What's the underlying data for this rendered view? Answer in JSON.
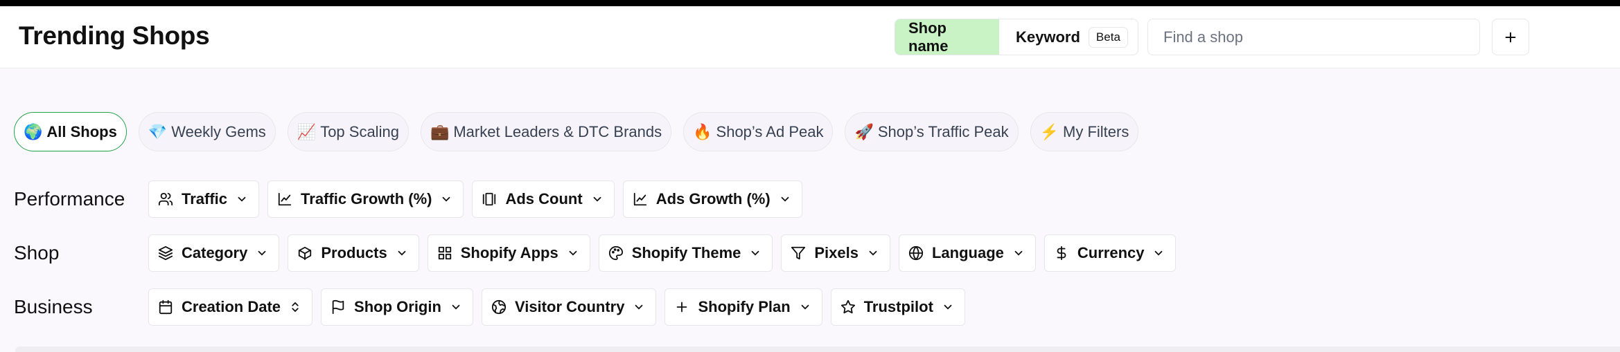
{
  "header": {
    "title": "Trending Shops",
    "mode_tabs": [
      {
        "label": "Shop name",
        "active": true
      },
      {
        "label": "Keyword",
        "badge": "Beta",
        "active": false
      }
    ],
    "search": {
      "placeholder": "Find a shop",
      "value": ""
    },
    "add_icon": "plus-icon"
  },
  "presets": [
    {
      "emoji": "🌍",
      "label": "All Shops",
      "active": true
    },
    {
      "emoji": "💎",
      "label": "Weekly Gems"
    },
    {
      "emoji": "📈",
      "label": "Top Scaling"
    },
    {
      "emoji": "💼",
      "label": "Market Leaders & DTC Brands"
    },
    {
      "emoji": "🔥",
      "label": "Shop’s Ad Peak"
    },
    {
      "emoji": "🚀",
      "label": "Shop’s Traffic Peak"
    },
    {
      "emoji": "⚡",
      "label": "My Filters"
    }
  ],
  "filters": {
    "performance": {
      "label": "Performance",
      "items": [
        {
          "label": "Traffic",
          "icon": "users-icon"
        },
        {
          "label": "Traffic Growth (%)",
          "icon": "line-chart-icon"
        },
        {
          "label": "Ads Count",
          "icon": "gallery-icon"
        },
        {
          "label": "Ads Growth (%)",
          "icon": "line-chart-icon"
        }
      ]
    },
    "shop": {
      "label": "Shop",
      "items": [
        {
          "label": "Category",
          "icon": "layers-icon"
        },
        {
          "label": "Products",
          "icon": "box-icon"
        },
        {
          "label": "Shopify Apps",
          "icon": "grid-icon"
        },
        {
          "label": "Shopify Theme",
          "icon": "palette-icon"
        },
        {
          "label": "Pixels",
          "icon": "filter-icon"
        },
        {
          "label": "Language",
          "icon": "globe-icon"
        },
        {
          "label": "Currency",
          "icon": "dollar-icon"
        }
      ]
    },
    "business": {
      "label": "Business",
      "items": [
        {
          "label": "Creation Date",
          "icon": "calendar-icon"
        },
        {
          "label": "Shop Origin",
          "icon": "flag-icon"
        },
        {
          "label": "Visitor Country",
          "icon": "globe-grid-icon"
        },
        {
          "label": "Shopify Plan",
          "icon": "plus-icon"
        },
        {
          "label": "Trustpilot",
          "icon": "star-icon"
        }
      ]
    }
  }
}
